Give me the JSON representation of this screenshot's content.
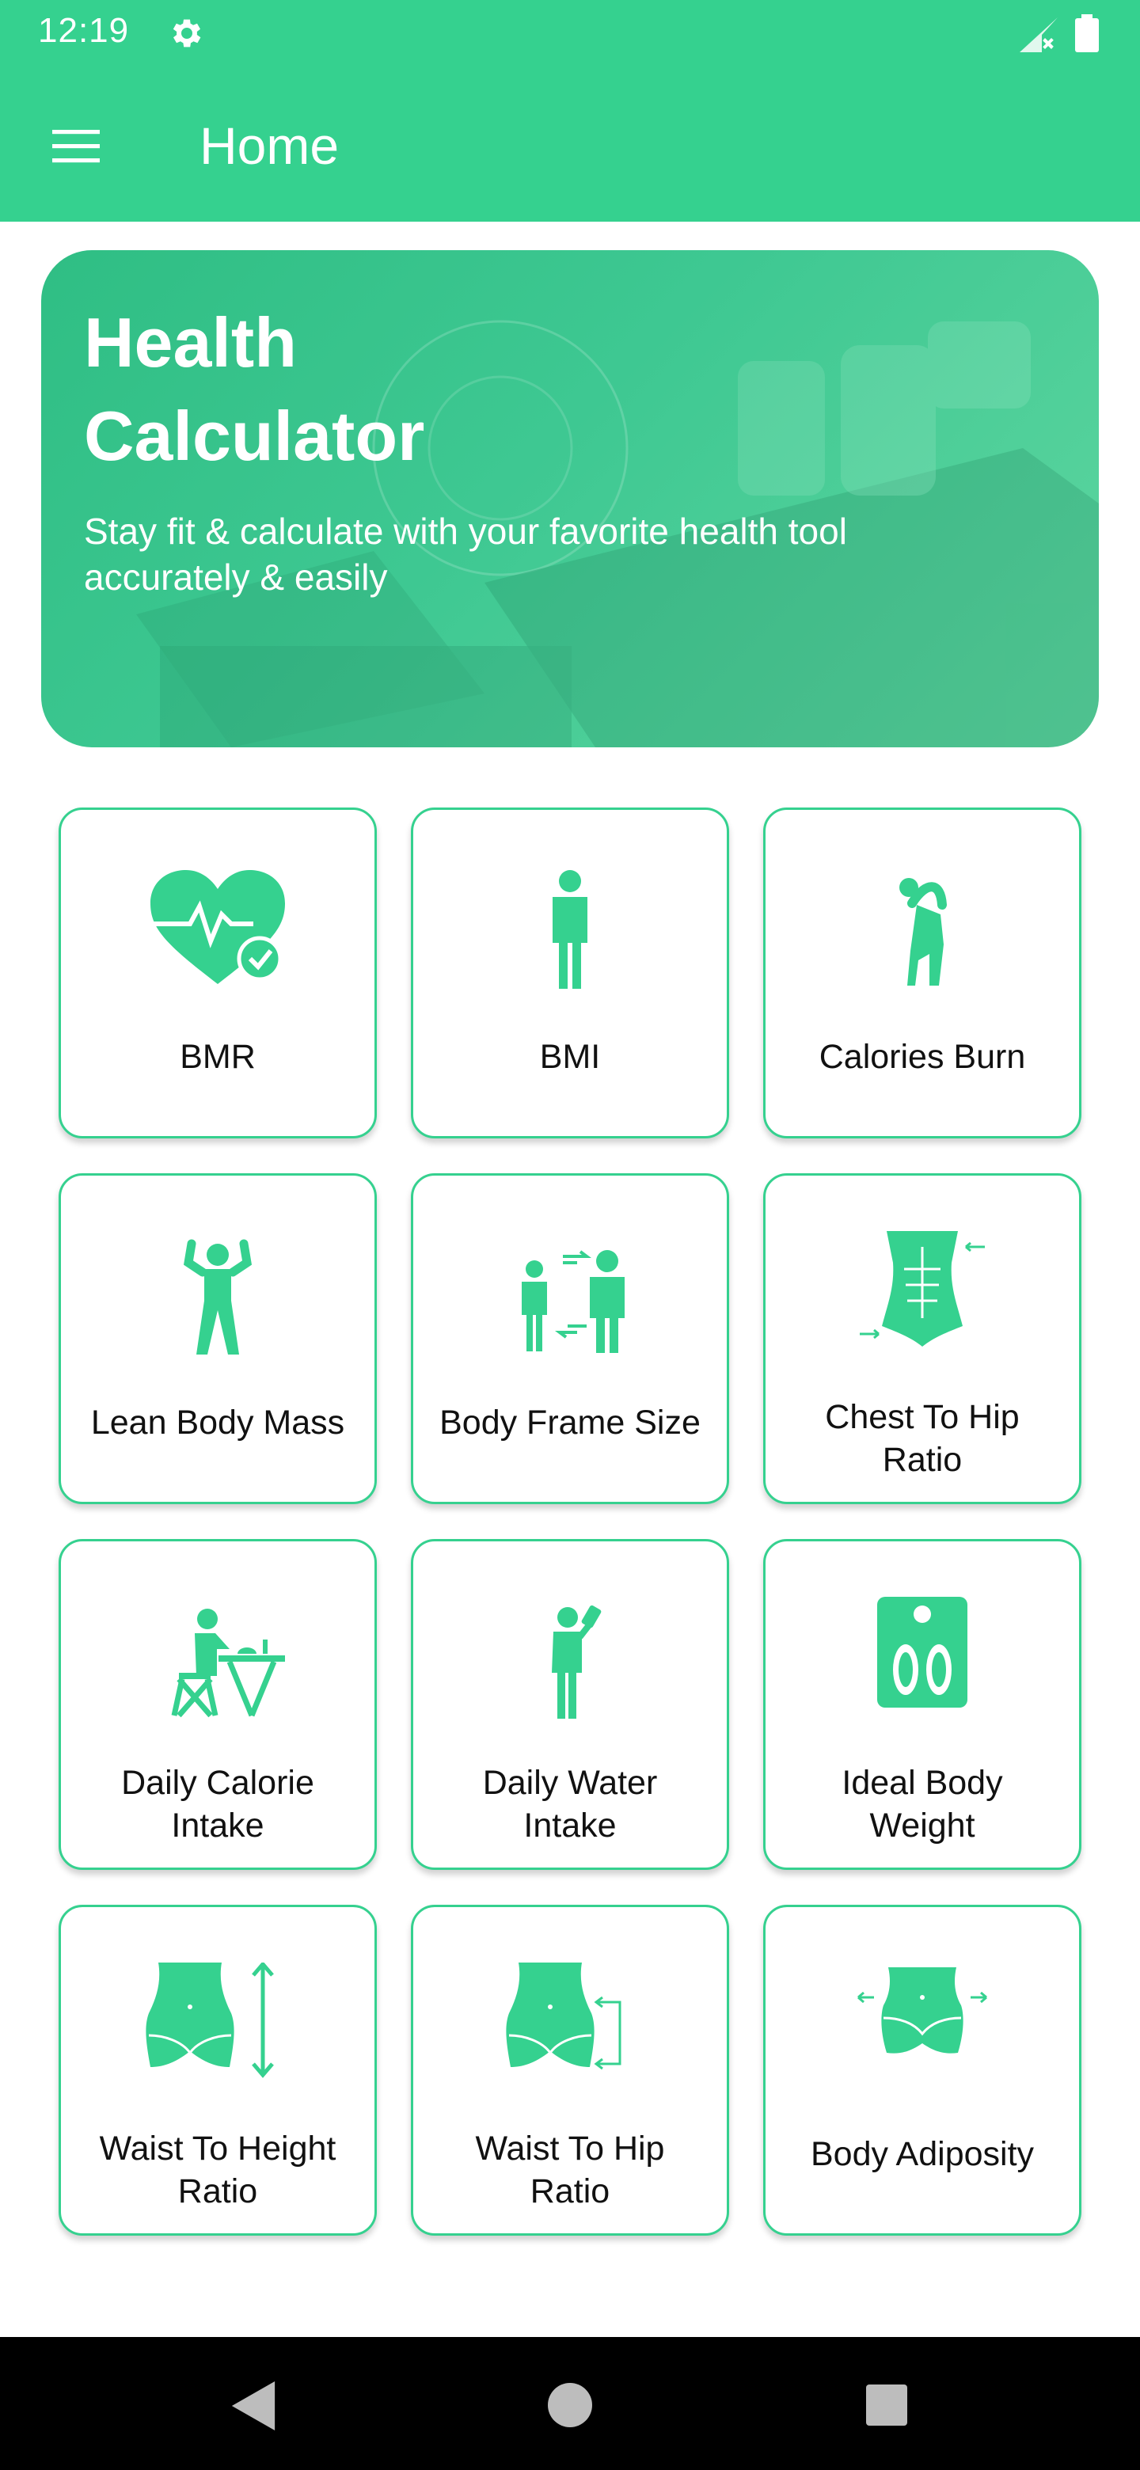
{
  "status_bar": {
    "time": "12:19",
    "icons": [
      "gear-icon",
      "signal-icon",
      "battery-icon"
    ]
  },
  "app_bar": {
    "title": "Home",
    "menu_icon": "hamburger-menu-icon"
  },
  "hero": {
    "title": "Health\nCalculator",
    "subtitle": "Stay fit & calculate with your favorite health tool accurately & easily"
  },
  "tools": [
    {
      "label": "BMR",
      "icon": "heart-check-icon"
    },
    {
      "label": "BMI",
      "icon": "person-standing-icon"
    },
    {
      "label": "Calories Burn",
      "icon": "stretching-person-icon"
    },
    {
      "label": "Lean Body Mass",
      "icon": "flexing-person-icon"
    },
    {
      "label": "Body Frame Size",
      "icon": "two-people-compare-icon"
    },
    {
      "label": "Chest To Hip\nRatio",
      "icon": "torso-icon"
    },
    {
      "label": "Daily Calorie\nIntake",
      "icon": "person-eating-icon"
    },
    {
      "label": "Daily Water\nIntake",
      "icon": "person-drinking-icon"
    },
    {
      "label": "Ideal Body\nWeight",
      "icon": "scale-feet-icon"
    },
    {
      "label": "Waist To Height\nRatio",
      "icon": "waist-height-icon"
    },
    {
      "label": "Waist To Hip\nRatio",
      "icon": "waist-hip-icon"
    },
    {
      "label": "Body Adiposity",
      "icon": "body-adiposity-icon"
    }
  ],
  "nav_bar": {
    "icons": [
      "back-icon",
      "home-icon",
      "recents-icon"
    ]
  },
  "colors": {
    "accent": "#35d18f",
    "card_border": "#35d18f",
    "text": "#111111",
    "nav": "#000000"
  }
}
